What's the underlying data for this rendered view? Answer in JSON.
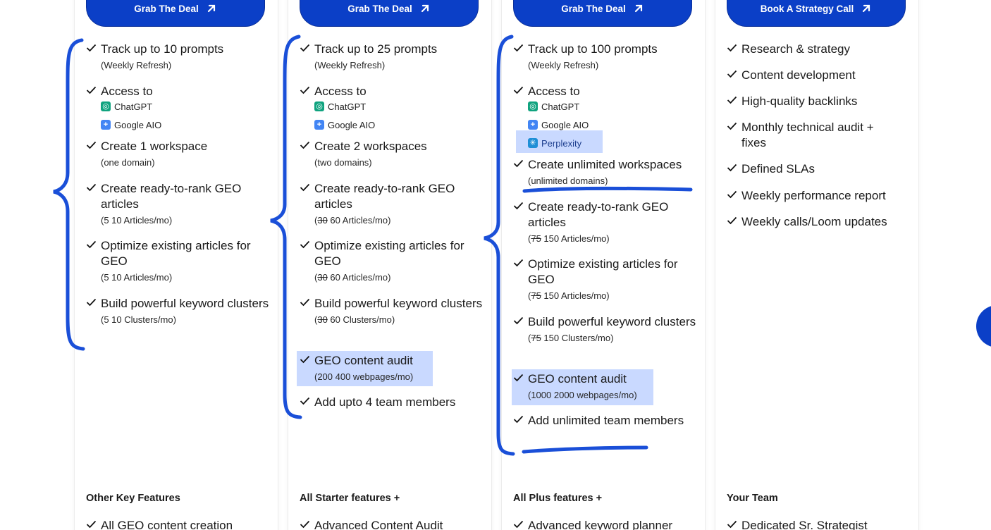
{
  "colors": {
    "accent": "#0b3fc7",
    "highlight": "#4c82ff",
    "marker": "#1a4fd8"
  },
  "icons": {
    "check": "check-icon",
    "arrow": "arrow-up-right-icon",
    "chatgpt": "chatgpt-icon",
    "google_aio": "google-aio-icon",
    "perplexity": "perplexity-icon"
  },
  "plans": [
    {
      "cta": "Grab The Deal",
      "features": [
        {
          "title": "Track up to 10 prompts",
          "sub": "(Weekly Refresh)"
        },
        {
          "title": "Access to",
          "llms": [
            "ChatGPT",
            "Google AIO"
          ]
        },
        {
          "title": "Create 1 workspace",
          "sub": "(one domain)"
        },
        {
          "title": "Create ready-to-rank GEO articles",
          "sub": "(5 10 Articles/mo)"
        },
        {
          "title": "Optimize existing articles for GEO",
          "sub": "(5 10 Articles/mo)"
        },
        {
          "title": "Build powerful keyword clusters",
          "sub": "(5 10 Clusters/mo)"
        }
      ],
      "section": "Other Key Features",
      "next": "All GEO content creation"
    },
    {
      "cta": "Grab The Deal",
      "features": [
        {
          "title": "Track up to 25 prompts",
          "sub": "(Weekly Refresh)"
        },
        {
          "title": "Access to",
          "llms": [
            "ChatGPT",
            "Google AIO"
          ]
        },
        {
          "title": "Create 2 workspaces",
          "sub": "(two domains)"
        },
        {
          "title": "Create ready-to-rank GEO articles",
          "sub_pre": "(",
          "sub_strike": "30",
          "sub_post": " 60 Articles/mo)"
        },
        {
          "title": "Optimize existing articles for GEO",
          "sub_pre": "(",
          "sub_strike": "30",
          "sub_post": " 60 Articles/mo)"
        },
        {
          "title": "Build powerful keyword clusters",
          "sub_pre": "(",
          "sub_strike": "30",
          "sub_post": " 60 Clusters/mo)"
        },
        {
          "title": "GEO content audit",
          "sub": "(200 400 webpages/mo)"
        },
        {
          "title": "Add upto 4 team members"
        }
      ],
      "section": "All Starter features +",
      "next": "Advanced Content Audit"
    },
    {
      "cta": "Grab The Deal",
      "features": [
        {
          "title": "Track up to 100 prompts",
          "sub": "(Weekly Refresh)"
        },
        {
          "title": "Access to",
          "llms": [
            "ChatGPT",
            "Google AIO",
            "Perplexity"
          ]
        },
        {
          "title": "Create unlimited workspaces",
          "sub": "(unlimited domains)"
        },
        {
          "title": "Create ready-to-rank GEO articles",
          "sub_pre": "(",
          "sub_strike": "75",
          "sub_post": " 150 Articles/mo)"
        },
        {
          "title": "Optimize existing articles for GEO",
          "sub_pre": "(",
          "sub_strike": "75",
          "sub_post": " 150 Articles/mo)"
        },
        {
          "title": "Build powerful keyword clusters",
          "sub_pre": "(",
          "sub_strike": "75",
          "sub_post": " 150 Clusters/mo)"
        },
        {
          "title": "GEO content audit",
          "sub": "(1000 2000 webpages/mo)"
        },
        {
          "title": "Add unlimited team members"
        }
      ],
      "section": "All Plus features +",
      "next": "Advanced keyword planner"
    },
    {
      "cta": "Book A Strategy Call",
      "features": [
        {
          "title": "Research & strategy"
        },
        {
          "title": "Content development"
        },
        {
          "title": "High-quality backlinks"
        },
        {
          "title": "Monthly technical audit + fixes"
        },
        {
          "title": "Defined SLAs"
        },
        {
          "title": "Weekly performance report"
        },
        {
          "title": "Weekly calls/Loom updates"
        }
      ],
      "section": "Your Team",
      "next": "Dedicated Sr. Strategist"
    }
  ]
}
